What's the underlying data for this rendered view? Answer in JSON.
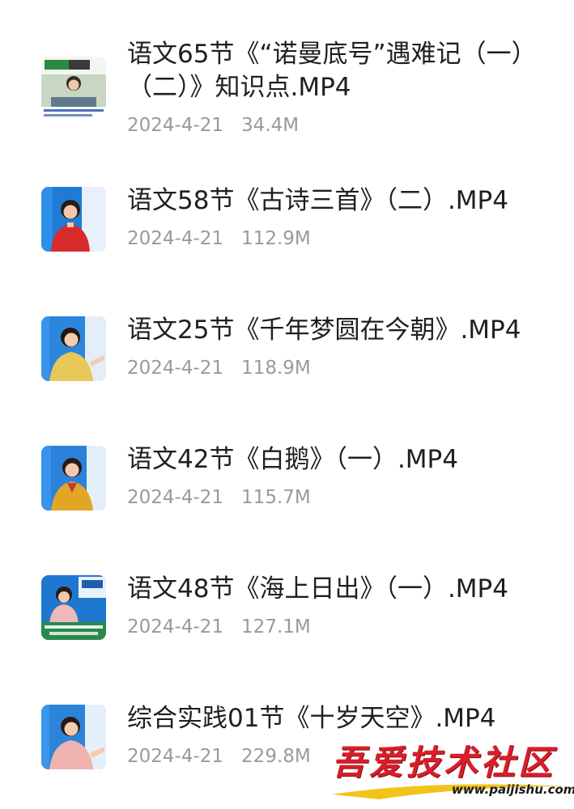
{
  "files": [
    {
      "name": "语文65节《“诺曼底号”遇难记（一）（二）》知识点.MP4",
      "date": "2024-4-21",
      "size": "34.4M",
      "thumbnail": "video-thumbnail-classroom-icon"
    },
    {
      "name": "语文58节《古诗三首》（二）.MP4",
      "date": "2024-4-21",
      "size": "112.9M",
      "thumbnail": "video-thumbnail-teacher-icon"
    },
    {
      "name": "语文25节《千年梦圆在今朝》.MP4",
      "date": "2024-4-21",
      "size": "118.9M",
      "thumbnail": "video-thumbnail-teacher-icon"
    },
    {
      "name": "语文42节《白鹅》（一）.MP4",
      "date": "2024-4-21",
      "size": "115.7M",
      "thumbnail": "video-thumbnail-teacher-icon"
    },
    {
      "name": "语文48节《海上日出》（一）.MP4",
      "date": "2024-4-21",
      "size": "127.1M",
      "thumbnail": "video-thumbnail-teacher-icon"
    },
    {
      "name": "综合实践01节《十岁天空》.MP4",
      "date": "2024-4-21",
      "size": "229.8M",
      "thumbnail": "video-thumbnail-teacher-icon"
    }
  ],
  "watermark": {
    "title": "吾爱技术社区",
    "url": "www.paijishu.com"
  },
  "colors": {
    "file_name": "#1f1f1f",
    "meta": "#9a9a9a",
    "watermark_red": "#d81e2a",
    "thumb_blue": "#1f7bd6"
  }
}
